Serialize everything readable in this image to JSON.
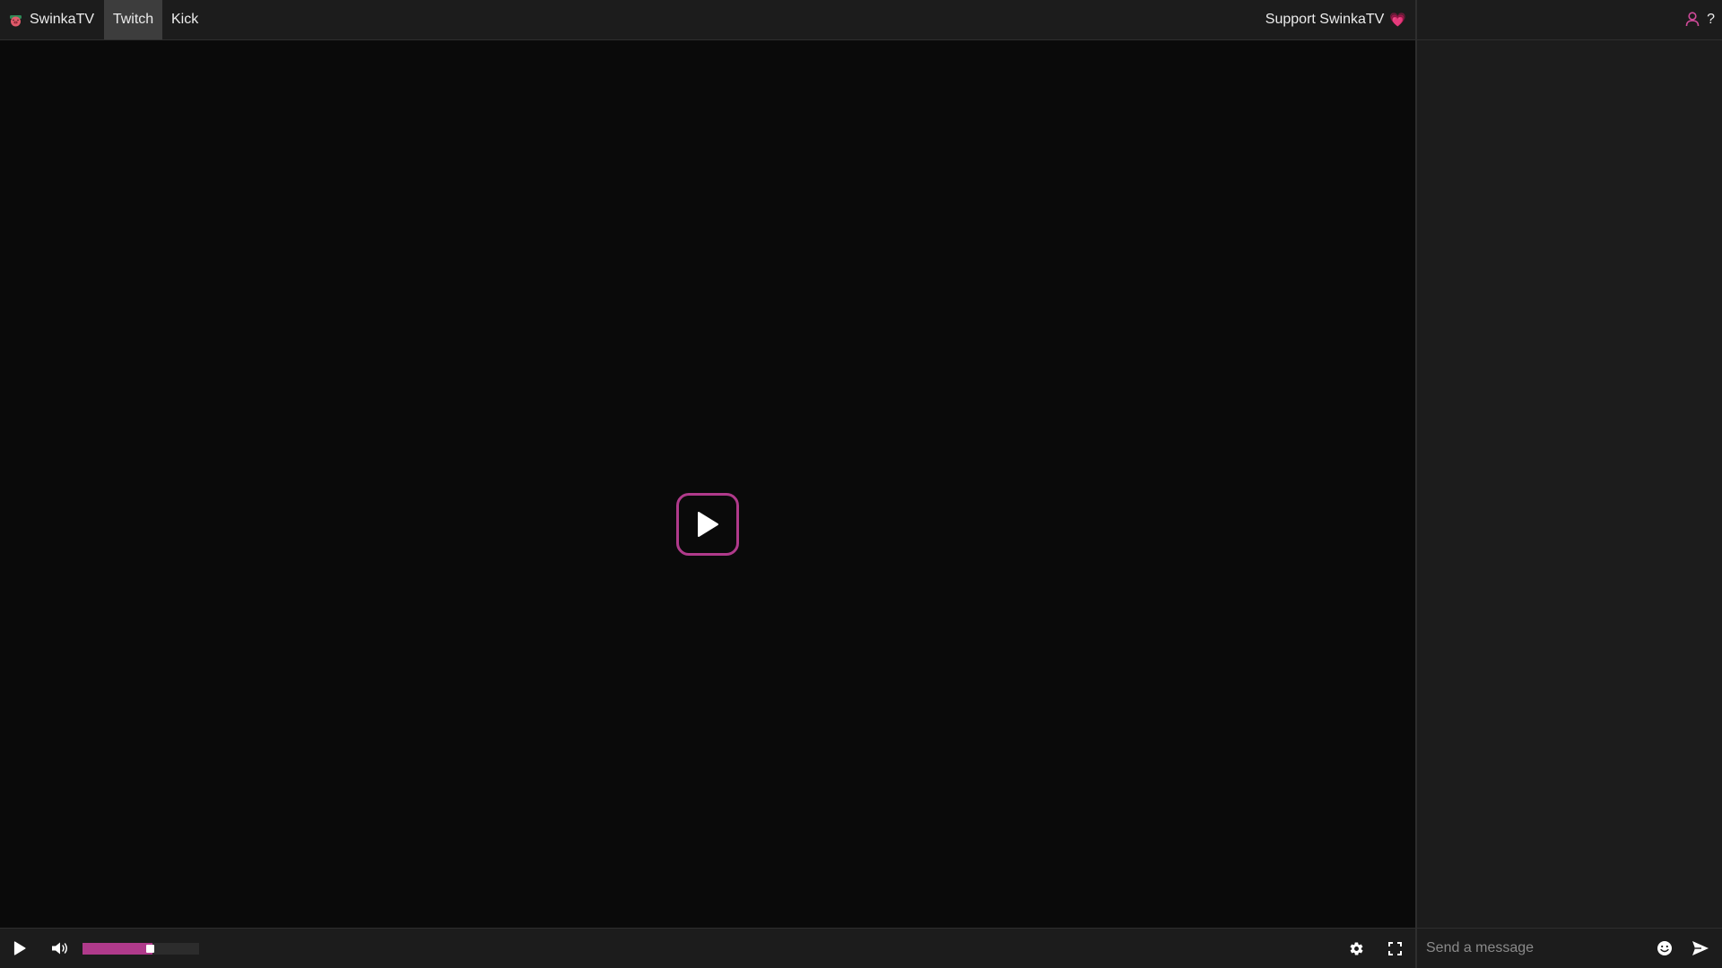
{
  "header": {
    "brand_label": "SwinkaTV",
    "brand_icon": "pig-logo-icon",
    "tabs": [
      {
        "label": "Twitch",
        "active": true
      },
      {
        "label": "Kick",
        "active": false
      }
    ],
    "support_label": "Support SwinkaTV",
    "support_emoji": "💗"
  },
  "player": {
    "big_play_icon": "play-icon",
    "accent_color": "#b03a8b",
    "volume_level": 0.6
  },
  "chat": {
    "user_icon": "user-icon",
    "help_label": "?",
    "input_placeholder": "Send a message",
    "emoji_icon": "smiley-icon",
    "send_icon": "send-icon"
  }
}
